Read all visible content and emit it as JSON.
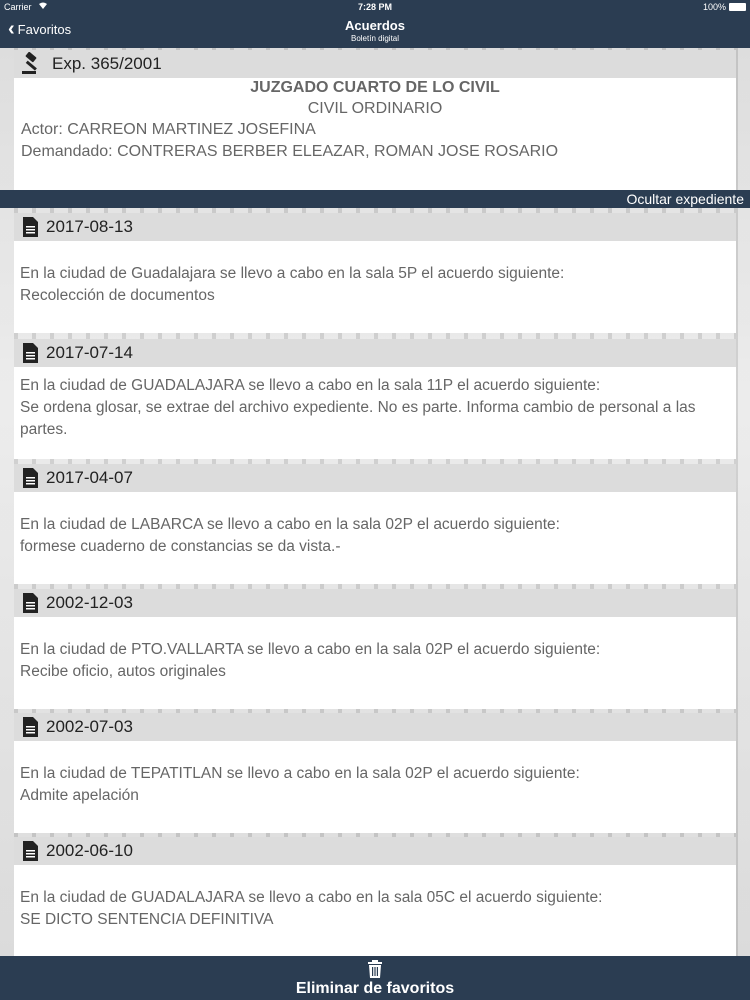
{
  "status_bar": {
    "carrier": "Carrier",
    "time": "7:28 PM",
    "battery": "100%"
  },
  "nav": {
    "back_label": "Favoritos",
    "title": "Acuerdos",
    "subtitle": "Boletín digital"
  },
  "expediente": {
    "number": "Exp. 365/2001",
    "court": "JUZGADO CUARTO DE LO CIVIL",
    "type": "CIVIL ORDINARIO",
    "actor": "Actor: CARREON MARTINEZ JOSEFINA",
    "demandado": "Demandado: CONTRERAS BERBER ELEAZAR, ROMAN JOSE ROSARIO"
  },
  "hide_label": "Ocultar expediente",
  "entries": [
    {
      "date": "2017-08-13",
      "line1": "En la ciudad de Guadalajara se llevo a cabo en la sala 5P el acuerdo siguiente:",
      "line2": "Recolección de documentos"
    },
    {
      "date": "2017-07-14",
      "line1": "En la ciudad de GUADALAJARA se llevo a cabo en la sala 11P el acuerdo siguiente:",
      "line2": "Se ordena glosar, se extrae del archivo expediente. No es parte. Informa cambio de personal a las partes."
    },
    {
      "date": "2017-04-07",
      "line1": "En la ciudad de LABARCA se llevo a cabo en la sala 02P el acuerdo siguiente:",
      "line2": "formese cuaderno de constancias se da vista.-"
    },
    {
      "date": "2002-12-03",
      "line1": "En la ciudad de PTO.VALLARTA se llevo a cabo en la sala 02P el acuerdo siguiente:",
      "line2": "Recibe oficio, autos originales"
    },
    {
      "date": "2002-07-03",
      "line1": "En la ciudad de TEPATITLAN se llevo a cabo en la sala 02P el acuerdo siguiente:",
      "line2": "Admite apelación"
    },
    {
      "date": "2002-06-10",
      "line1": "En la ciudad de GUADALAJARA se llevo a cabo en la sala 05C el acuerdo siguiente:",
      "line2": "SE DICTO SENTENCIA DEFINITIVA"
    }
  ],
  "bottom": {
    "label": "Eliminar de favoritos"
  },
  "icons": {
    "back": "chevron-left-icon",
    "expediente": "gavel-icon",
    "entry": "document-icon",
    "bottom": "trash-icon"
  },
  "colors": {
    "bar": "#2b3d52",
    "header_bg": "#dcdcdc",
    "text": "#666666"
  }
}
